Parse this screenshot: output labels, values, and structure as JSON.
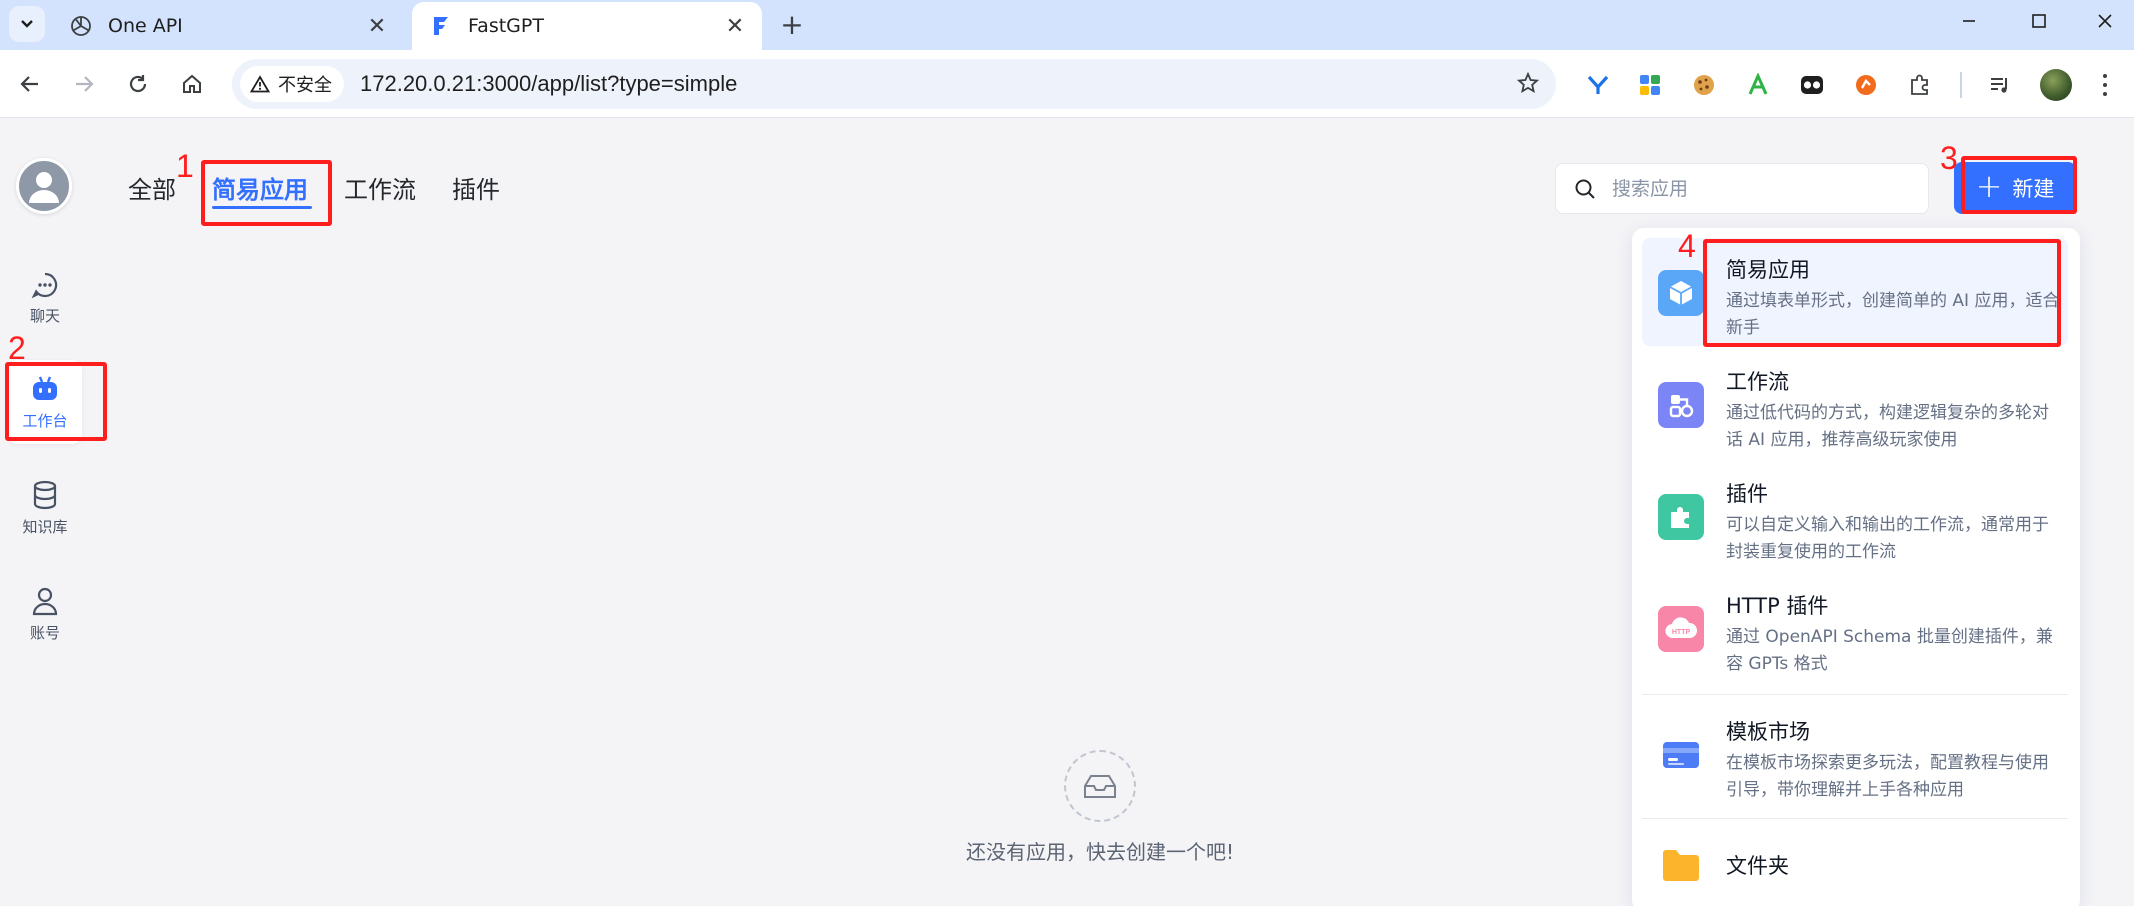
{
  "browser": {
    "tabs": [
      {
        "title": "One API",
        "icon": "openai-logo-icon",
        "active": false
      },
      {
        "title": "FastGPT",
        "icon": "fastgpt-logo-icon",
        "active": true
      }
    ],
    "security_chip": "不安全",
    "url": "172.20.0.21:3000/app/list?type=simple",
    "extensions": [
      "y-extension-icon",
      "apps-extension-icon",
      "cookie-extension-icon",
      "a-extension-icon",
      "glasses-extension-icon",
      "orange-extension-icon",
      "puzzle-extensions-icon",
      "media-queue-icon"
    ]
  },
  "sidebar": {
    "items": [
      {
        "label": "聊天",
        "icon": "chat-icon",
        "active": false
      },
      {
        "label": "工作台",
        "icon": "robot-workbench-icon",
        "active": true
      },
      {
        "label": "知识库",
        "icon": "database-icon",
        "active": false
      },
      {
        "label": "账号",
        "icon": "user-icon",
        "active": false
      }
    ]
  },
  "header": {
    "tabs": [
      {
        "label": "全部",
        "active": false
      },
      {
        "label": "简易应用",
        "active": true
      },
      {
        "label": "工作流",
        "active": false
      },
      {
        "label": "插件",
        "active": false
      }
    ],
    "search_placeholder": "搜索应用",
    "new_button": "新建",
    "new_button_icon": "+"
  },
  "create_menu": {
    "items": [
      {
        "title": "简易应用",
        "desc": "通过填表单形式，创建简单的 AI 应用，适合新手",
        "icon": "cube-icon",
        "color": "#5aa7f8"
      },
      {
        "title": "工作流",
        "desc": "通过低代码的方式，构建逻辑复杂的多轮对话 AI 应用，推荐高级玩家使用",
        "icon": "workflow-icon",
        "color": "#7b85f6"
      },
      {
        "title": "插件",
        "desc": "可以自定义输入和输出的工作流，通常用于封装重复使用的工作流",
        "icon": "puzzle-icon",
        "color": "#3fc7a1"
      },
      {
        "title": "HTTP 插件",
        "desc": "通过 OpenAPI Schema 批量创建插件，兼容 GPTs 格式",
        "icon": "http-cloud-icon",
        "color": "#f786a8",
        "badge": "HTTP"
      },
      {
        "title": "模板市场",
        "desc": "在模板市场探索更多玩法，配置教程与使用引导，带你理解并上手各种应用",
        "icon": "template-card-icon",
        "color": "#4e7cf6"
      },
      {
        "title": "文件夹",
        "icon": "folder-icon",
        "color": "#fbb42c"
      }
    ]
  },
  "empty_state": {
    "text": "还没有应用，快去创建一个吧!",
    "icon": "empty-inbox-icon"
  },
  "annotations": [
    "1",
    "2",
    "3",
    "4"
  ],
  "colors": {
    "accent": "#3370ff",
    "annotation": "#ff1e1e"
  }
}
